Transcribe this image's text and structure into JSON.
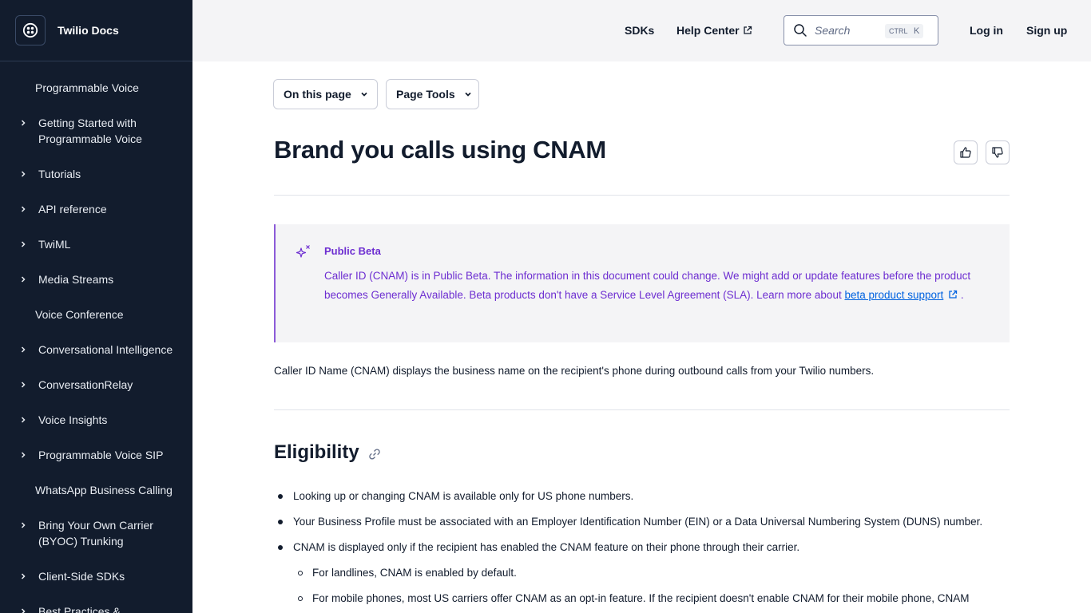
{
  "sidebar": {
    "brand": "Twilio Docs",
    "items": [
      {
        "label": "Programmable Voice",
        "chevron": false
      },
      {
        "label": "Getting Started with Programmable Voice",
        "chevron": true
      },
      {
        "label": "Tutorials",
        "chevron": true
      },
      {
        "label": "API reference",
        "chevron": true
      },
      {
        "label": "TwiML",
        "chevron": true
      },
      {
        "label": "Media Streams",
        "chevron": true
      },
      {
        "label": "Voice Conference",
        "chevron": false
      },
      {
        "label": "Conversational Intelligence",
        "chevron": true
      },
      {
        "label": "ConversationRelay",
        "chevron": true
      },
      {
        "label": "Voice Insights",
        "chevron": true
      },
      {
        "label": "Programmable Voice SIP",
        "chevron": true
      },
      {
        "label": "WhatsApp Business Calling",
        "chevron": false
      },
      {
        "label": "Bring Your Own Carrier (BYOC) Trunking",
        "chevron": true
      },
      {
        "label": "Client-Side SDKs",
        "chevron": true
      },
      {
        "label": "Best Practices &",
        "chevron": true
      }
    ]
  },
  "header": {
    "sdks": "SDKs",
    "help_center": "Help Center",
    "search_placeholder": "Search",
    "kbd_ctrl": "CTRL",
    "kbd_k": "K",
    "login": "Log in",
    "signup": "Sign up"
  },
  "toolbar": {
    "on_this_page": "On this page",
    "page_tools": "Page Tools"
  },
  "page": {
    "title": "Brand you calls using CNAM",
    "callout": {
      "title": "Public Beta",
      "body": "Caller ID (CNAM) is in Public Beta. The information in this document could change. We might add or update features before the product becomes Generally Available. Beta products don't have a Service Level Agreement (SLA). Learn more about ",
      "link": "beta product support",
      "end": "."
    },
    "intro": "Caller ID Name (CNAM) displays the business name on the recipient's phone during outbound calls from your Twilio numbers.",
    "eligibility_heading": "Eligibility",
    "bullets": [
      "Looking up or changing CNAM is available only for US phone numbers.",
      "Your Business Profile must be associated with an Employer Identification Number (EIN) or a Data Universal Numbering System (DUNS) number.",
      "CNAM is displayed only if the recipient has enabled the CNAM feature on their phone through their carrier."
    ],
    "sub_bullets": [
      "For landlines, CNAM is enabled by default.",
      "For mobile phones, most US carriers offer CNAM as an opt-in feature. If the recipient doesn't enable CNAM for their mobile phone, CNAM"
    ]
  },
  "colors": {
    "sidebar_bg": "#121c2d",
    "header_bg": "#f4f4f6",
    "callout_accent": "#6d2ed1",
    "link": "#0263e0"
  }
}
